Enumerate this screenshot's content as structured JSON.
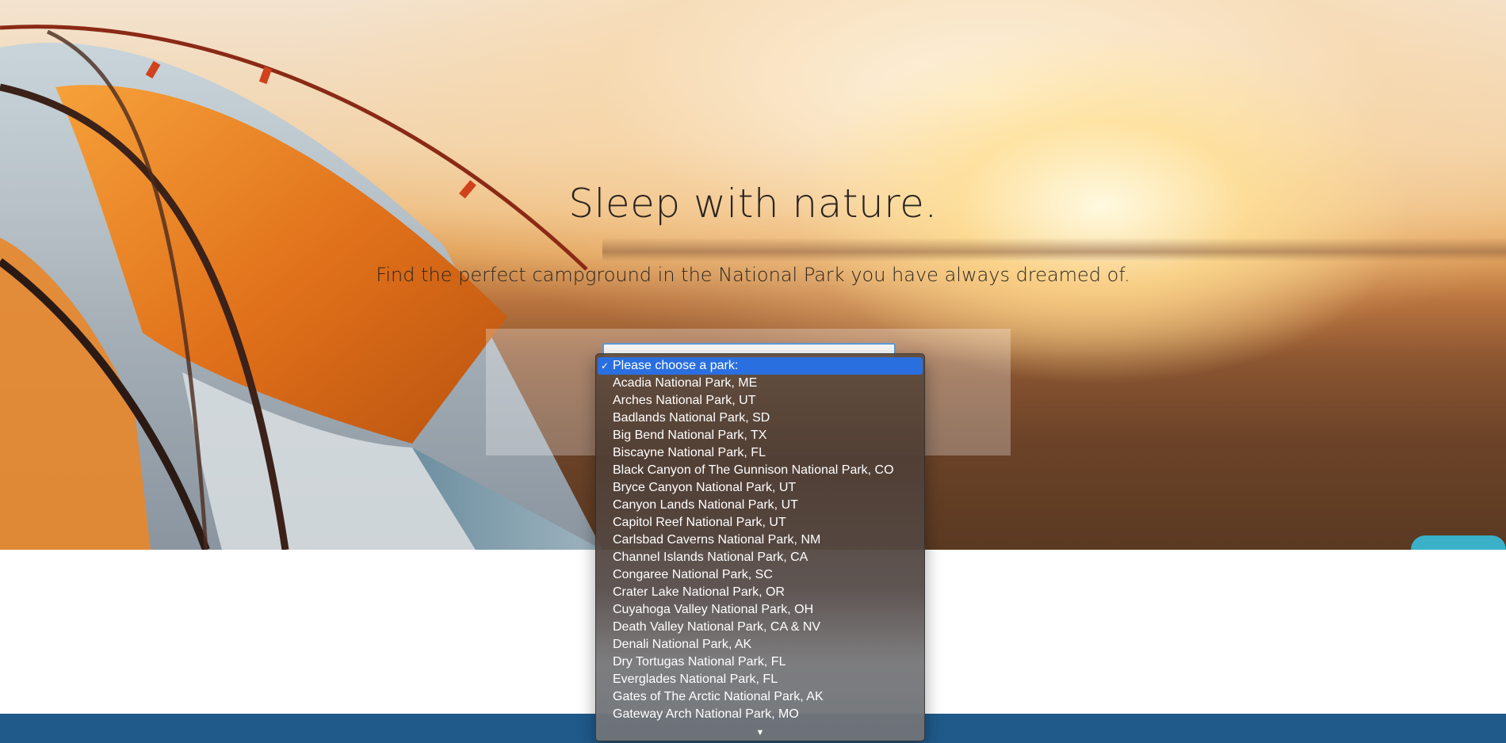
{
  "hero": {
    "headline": "Sleep with nature.",
    "subline": "Find the perfect campground in the National Park you have always dreamed of."
  },
  "park_select": {
    "selected": "Please choose a park:",
    "options": [
      "Acadia National Park, ME",
      "Arches National Park, UT",
      "Badlands National Park, SD",
      "Big Bend National Park, TX",
      "Biscayne National Park, FL",
      "Black Canyon of The Gunnison National Park, CO",
      "Bryce Canyon National Park, UT",
      "Canyon Lands National Park, UT",
      "Capitol Reef National Park, UT",
      "Carlsbad Caverns National Park, NM",
      "Channel Islands National Park, CA",
      "Congaree National Park, SC",
      "Crater Lake National Park, OR",
      "Cuyahoga Valley National Park, OH",
      "Death Valley National Park, CA & NV",
      "Denali National Park, AK",
      "Dry Tortugas National Park, FL",
      "Everglades National Park, FL",
      "Gates of The Arctic National Park, AK",
      "Gateway Arch National Park, MO"
    ],
    "check_glyph": "✓",
    "scroll_glyph": "▼"
  },
  "colors": {
    "accent": "#2a6fdf",
    "footer": "#1f5a8a",
    "select_border": "#5b9bd8"
  }
}
